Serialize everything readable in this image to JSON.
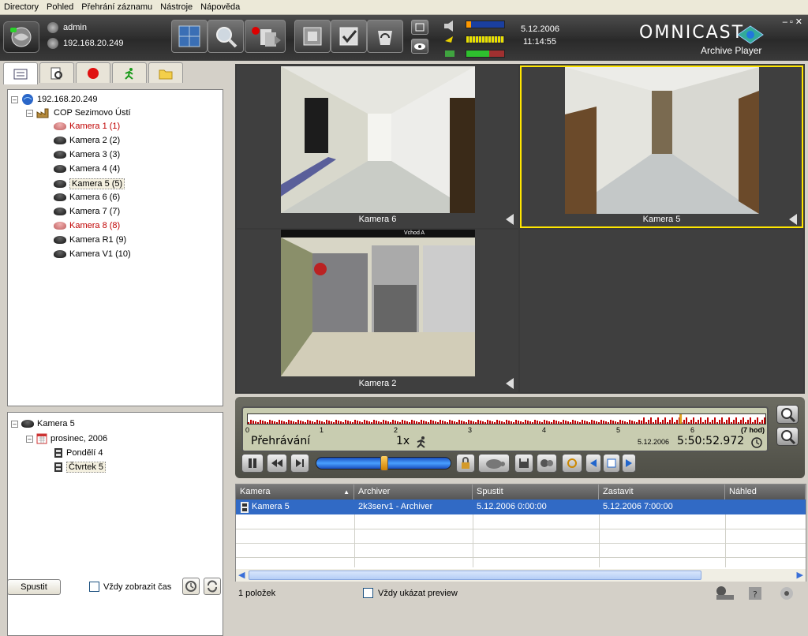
{
  "menu": [
    "Directory",
    "Pohled",
    "Přehrání záznamu",
    "Nástroje",
    "Nápověda"
  ],
  "user": {
    "name": "admin",
    "server": "192.168.20.249"
  },
  "datetime": {
    "date": "5.12.2006",
    "time": "11:14:55"
  },
  "brand": {
    "name": "OMNICAST",
    "product": "Archive Player"
  },
  "window_buttons": "–▫✕",
  "tree": {
    "root": "192.168.20.249",
    "site": "COP Sezimovo Ústí",
    "cameras": [
      {
        "label": "Kamera 1 (1)",
        "offline": true
      },
      {
        "label": "Kamera 2 (2)",
        "offline": false
      },
      {
        "label": "Kamera 3 (3)",
        "offline": false
      },
      {
        "label": "Kamera 4 (4)",
        "offline": false
      },
      {
        "label": "Kamera 5 (5)",
        "offline": false,
        "selected": true
      },
      {
        "label": "Kamera 6 (6)",
        "offline": false
      },
      {
        "label": "Kamera 7 (7)",
        "offline": false
      },
      {
        "label": "Kamera 8 (8)",
        "offline": true
      },
      {
        "label": "Kamera R1 (9)",
        "offline": false
      },
      {
        "label": "Kamera V1 (10)",
        "offline": false
      }
    ]
  },
  "archive_tree": {
    "camera": "Kamera 5",
    "month": "prosinec, 2006",
    "days": [
      "Pondělí 4",
      "Čtvrtek 5"
    ]
  },
  "left_bottom": {
    "start_button": "Spustit",
    "always_show_time": "Vždy zobrazit čas"
  },
  "tiles": [
    {
      "caption": "Kamera 6",
      "active": false
    },
    {
      "caption": "Kamera 5",
      "active": true
    },
    {
      "caption": "Kamera 2",
      "active": false
    },
    {
      "caption": "",
      "active": false
    }
  ],
  "tile_overlay_text": "Vchod A",
  "timeline": {
    "ticks": [
      "0",
      "1",
      "2",
      "3",
      "4",
      "5",
      "6"
    ],
    "end_label": "(7 hod)",
    "mode": "Přehrávání",
    "speed": "1x",
    "date": "5.12.2006",
    "time": "5:50:52.972",
    "playhead_hours": 5.82,
    "speed_fraction": 0.5,
    "total_hours": 7
  },
  "grid": {
    "columns": [
      "Kamera",
      "Archiver",
      "Spustit",
      "Zastavit",
      "Náhled"
    ],
    "rows": [
      {
        "camera": "Kamera 5",
        "archiver": "2k3serv1 - Archiver",
        "start": "5.12.2006 0:00:00",
        "stop": "5.12.2006 7:00:00",
        "preview": ""
      }
    ]
  },
  "status": {
    "count": "1 položek",
    "always_preview": "Vždy ukázat preview"
  },
  "colors": {
    "accent": "#316ac5",
    "active_tile": "#ffe600",
    "record_red": "#c00000"
  }
}
